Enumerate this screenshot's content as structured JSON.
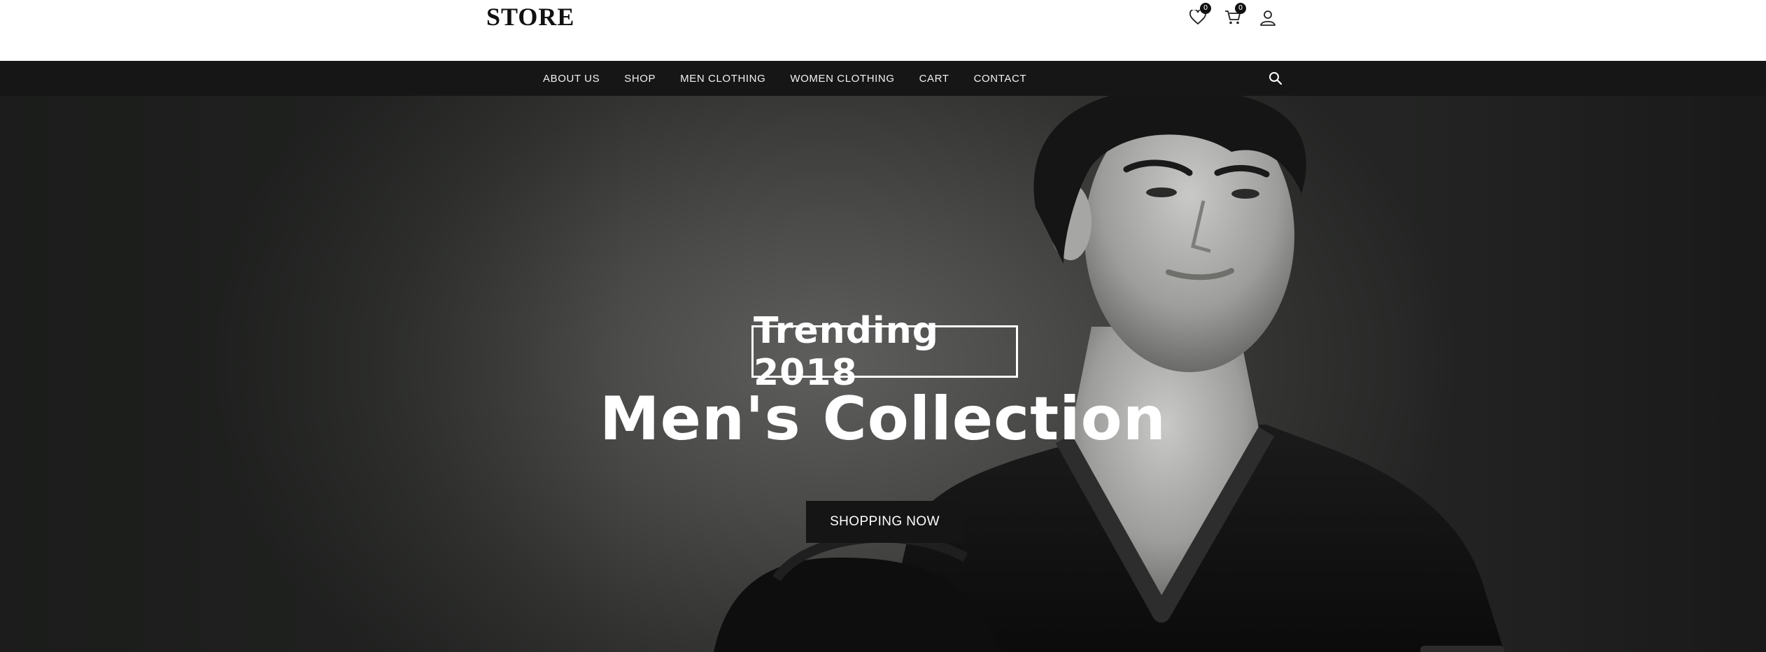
{
  "header": {
    "logo": "STORE",
    "wishlist_count": "0",
    "cart_count": "0",
    "icons": [
      "heart-icon",
      "cart-icon",
      "user-icon"
    ]
  },
  "nav": {
    "items": [
      {
        "label": "ABOUT US"
      },
      {
        "label": "SHOP"
      },
      {
        "label": "MEN CLOTHING"
      },
      {
        "label": "WOMEN CLOTHING"
      },
      {
        "label": "CART"
      },
      {
        "label": "CONTACT"
      }
    ],
    "search_icon": "search-icon"
  },
  "hero": {
    "tag": "Trending 2018",
    "headline": "Men's Collection",
    "cta": "SHOPPING NOW"
  },
  "colors": {
    "nav_bg": "#161616",
    "button_bg": "#151515",
    "hero_text": "#ffffff"
  }
}
